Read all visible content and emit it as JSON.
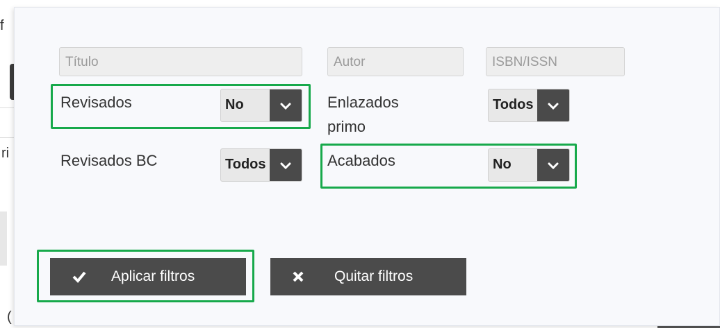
{
  "background": {
    "fragments": [
      "f",
      "ri",
      "("
    ]
  },
  "filters": {
    "titulo_placeholder": "Título",
    "autor_placeholder": "Autor",
    "isbn_placeholder": "ISBN/ISSN",
    "revisados": {
      "label": "Revisados",
      "value": "No"
    },
    "enlazados": {
      "label_line1": "Enlazados",
      "label_line2": "primo",
      "value": "Todos"
    },
    "revisados_bc": {
      "label": "Revisados BC",
      "value": "Todos"
    },
    "acabados": {
      "label": "Acabados",
      "value": "No"
    }
  },
  "actions": {
    "apply_label": "Aplicar filtros",
    "clear_label": "Quitar filtros"
  },
  "colors": {
    "highlight": "#17a94b",
    "button_bg": "#4b4b4b",
    "panel_bg": "#f8f9fc"
  },
  "icons": {
    "apply": "check-icon",
    "clear": "x-icon",
    "dropdown": "chevron-down-icon"
  }
}
